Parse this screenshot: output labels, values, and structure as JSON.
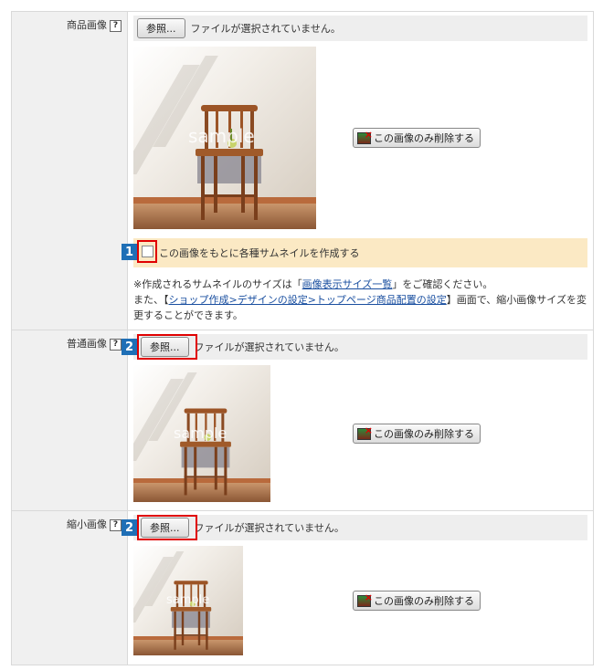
{
  "rows": [
    {
      "label": "商品画像",
      "help": "?",
      "browse": "参照...",
      "nofile": "ファイルが選択されていません。",
      "delete": "この画像のみ削除する"
    },
    {
      "label": "普通画像",
      "help": "?",
      "browse": "参照...",
      "nofile": "ファイルが選択されていません。",
      "delete": "この画像のみ削除する",
      "marker": "2"
    },
    {
      "label": "縮小画像",
      "help": "?",
      "browse": "参照...",
      "nofile": "ファイルが選択されていません。",
      "delete": "この画像のみ削除する",
      "marker": "2"
    }
  ],
  "thumbnail": {
    "marker": "1",
    "label": "この画像をもとに各種サムネイルを作成する"
  },
  "note": {
    "line1_a": "※作成されるサムネイルのサイズは「",
    "line1_link": "画像表示サイズ一覧",
    "line1_b": "」をご確認ください。",
    "line2_a": "また、【",
    "line2_link": "ショップ作成>デザインの設定>トップページ商品配置の設定",
    "line2_b": "】画面で、縮小画像サイズを変更することができます。"
  },
  "watermark": "sample",
  "icons": {
    "help": "help-icon",
    "delete": "delete-image-icon",
    "chair": "chair-photo"
  }
}
